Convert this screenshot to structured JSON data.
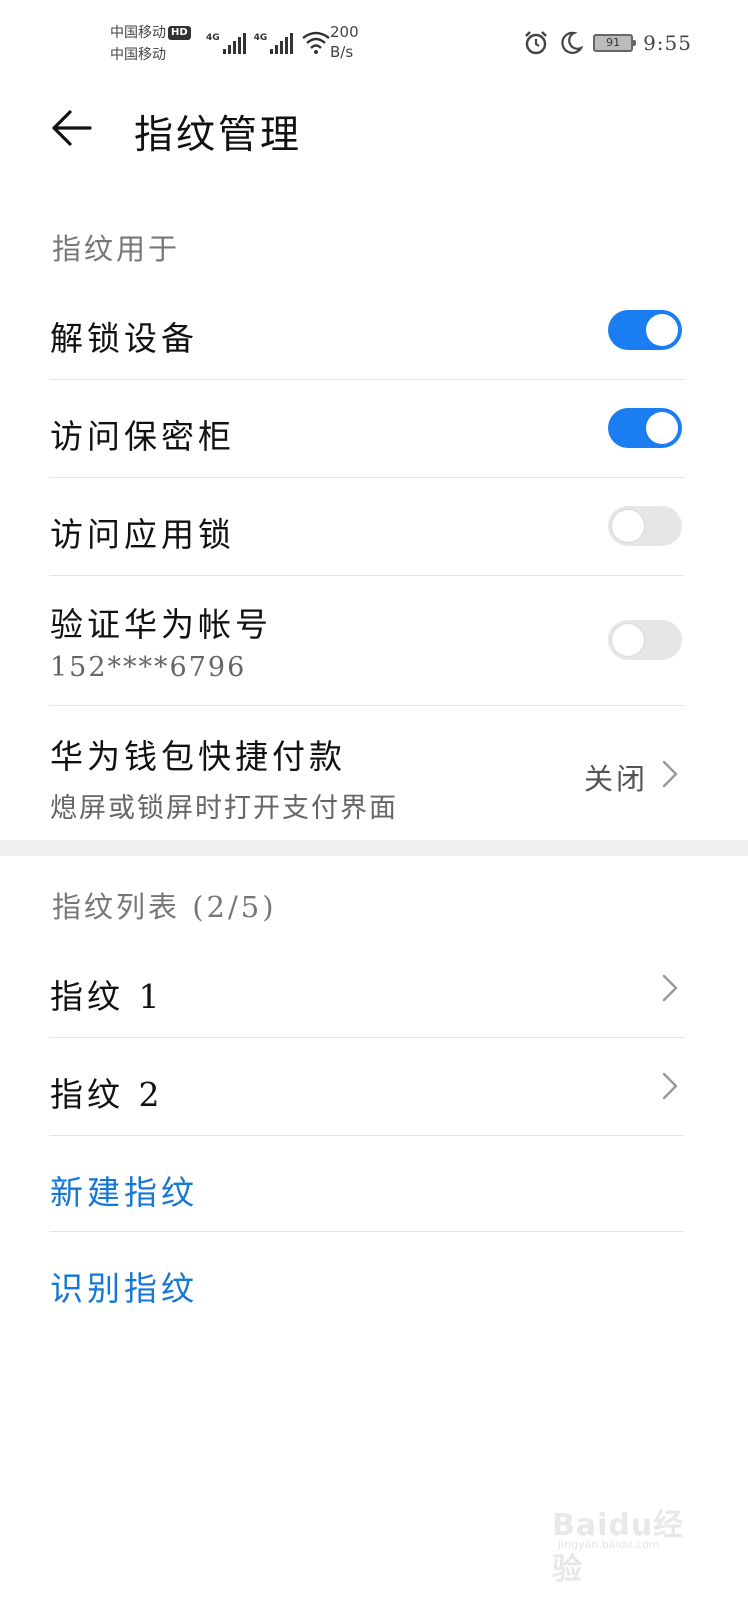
{
  "status_bar": {
    "carrier_1": "中国移动",
    "carrier_2": "中国移动",
    "hd": "HD",
    "network_1": "4G",
    "network_2": "4G",
    "speed_value": "200",
    "speed_unit": "B/s",
    "battery": "91",
    "time": "9:55",
    "icons": [
      "signal-icon",
      "wifi-icon",
      "alarm-icon",
      "moon-icon",
      "battery-icon"
    ]
  },
  "header": {
    "title": "指纹管理",
    "back_icon": "back-arrow-icon"
  },
  "usage_section": {
    "label": "指纹用于",
    "items": [
      {
        "title": "解锁设备",
        "toggle": true
      },
      {
        "title": "访问保密柜",
        "toggle": true
      },
      {
        "title": "访问应用锁",
        "toggle": false
      },
      {
        "title": "验证华为帐号",
        "subtitle": "152****6796",
        "toggle": false
      },
      {
        "title": "华为钱包快捷付款",
        "subtitle": "熄屏或锁屏时打开支付界面",
        "value": "关闭"
      }
    ]
  },
  "list_section": {
    "label": "指纹列表 (2/5)",
    "items": [
      {
        "title": "指纹 1"
      },
      {
        "title": "指纹 2"
      }
    ],
    "actions": [
      {
        "label": "新建指纹"
      },
      {
        "label": "识别指纹"
      }
    ]
  },
  "watermark": {
    "text": "Baidu经验",
    "url": "jingyan.baidu.com"
  },
  "colors": {
    "accent": "#1a7ef2",
    "link": "#1478d4",
    "toggle_off": "#e6e6e6"
  }
}
